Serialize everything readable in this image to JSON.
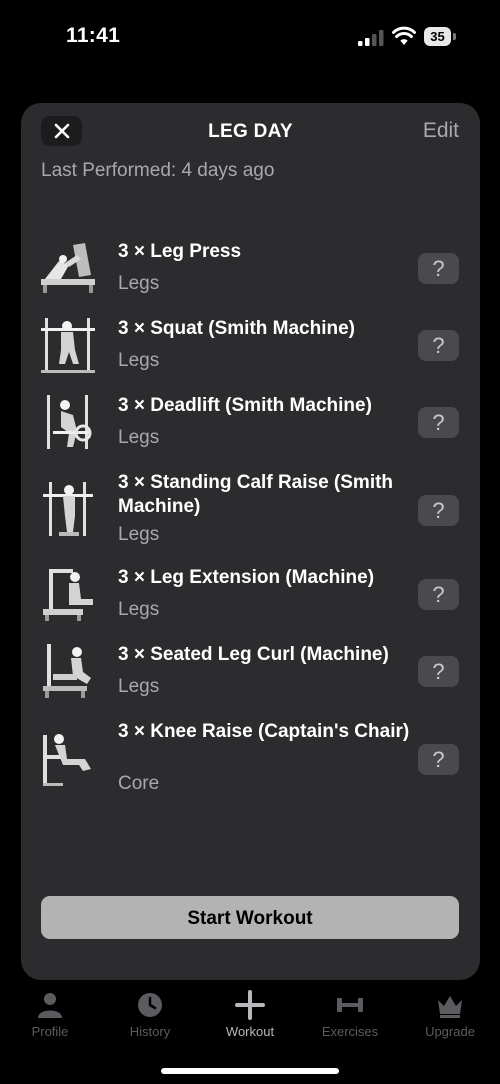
{
  "status": {
    "time": "11:41",
    "battery": "35"
  },
  "sheet": {
    "title": "LEG DAY",
    "edit_label": "Edit",
    "last_performed": "Last Performed: 4 days ago",
    "close_icon": "close-icon",
    "help_label": "?"
  },
  "exercises": [
    {
      "name": "3 × Leg Press",
      "category": "Legs",
      "icon": "leg-press-icon"
    },
    {
      "name": "3 × Squat (Smith Machine)",
      "category": "Legs",
      "icon": "smith-squat-icon"
    },
    {
      "name": "3 × Deadlift (Smith Machine)",
      "category": "Legs",
      "icon": "smith-deadlift-icon"
    },
    {
      "name": "3 × Standing Calf Raise (Smith Machine)",
      "category": "Legs",
      "icon": "calf-raise-icon"
    },
    {
      "name": "3 × Leg Extension (Machine)",
      "category": "Legs",
      "icon": "leg-extension-icon"
    },
    {
      "name": "3 × Seated Leg Curl (Machine)",
      "category": "Legs",
      "icon": "leg-curl-icon"
    },
    {
      "name": "3 × Knee Raise (Captain's Chair)",
      "category": "Core",
      "icon": "knee-raise-icon"
    }
  ],
  "start_button": "Start Workout",
  "tabs": [
    {
      "label": "Profile",
      "icon": "person-icon",
      "active": false
    },
    {
      "label": "History",
      "icon": "clock-icon",
      "active": false
    },
    {
      "label": "Workout",
      "icon": "plus-icon",
      "active": true
    },
    {
      "label": "Exercises",
      "icon": "dumbbell-icon",
      "active": false
    },
    {
      "label": "Upgrade",
      "icon": "crown-icon",
      "active": false
    }
  ],
  "colors": {
    "sheet_bg": "#2c2c2e",
    "secondary_text": "#a9a9ad",
    "button_bg": "#b3b3b3"
  }
}
